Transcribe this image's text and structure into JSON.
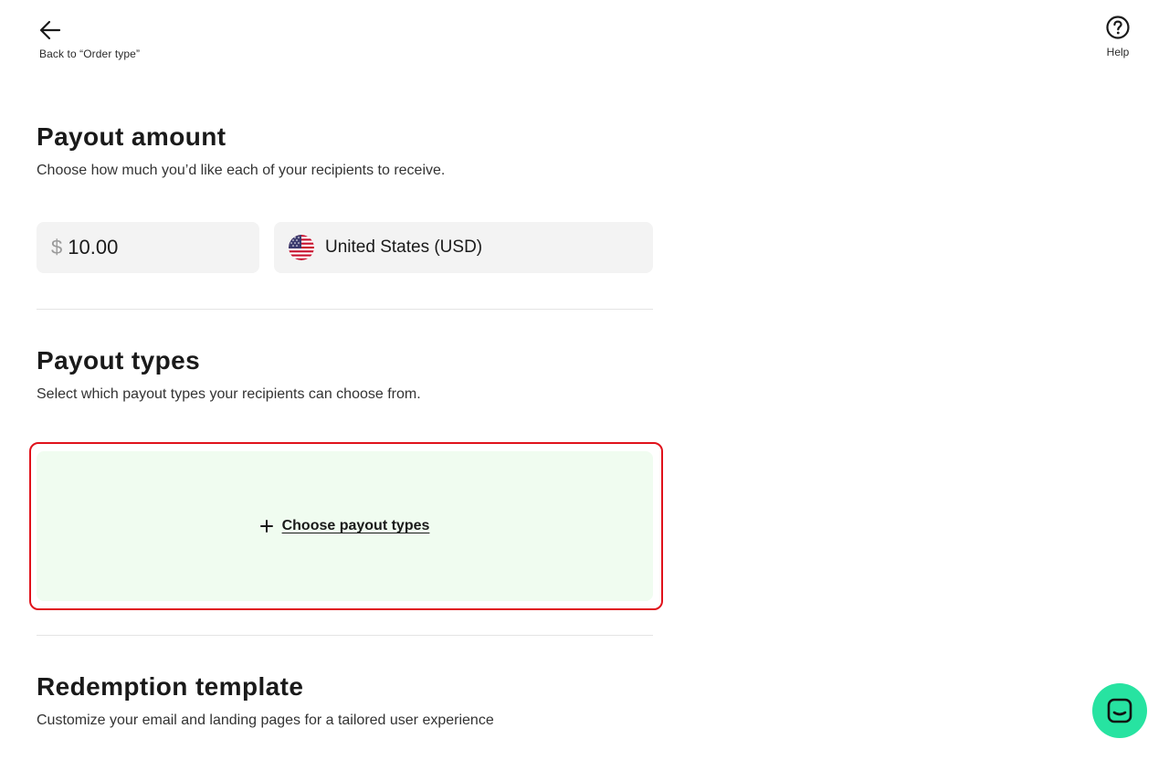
{
  "nav": {
    "back_label": "Back to “Order type”",
    "help_label": "Help"
  },
  "payout_amount": {
    "title": "Payout amount",
    "description": "Choose how much you’d like each of your recipients to receive.",
    "currency_symbol": "$",
    "amount_value": "10.00",
    "country_label": "United States (USD)",
    "flag_icon": "us-flag-icon"
  },
  "payout_types": {
    "title": "Payout types",
    "description": "Select which payout types your recipients can choose from.",
    "choose_label": "Choose payout types"
  },
  "redemption_template": {
    "title": "Redemption template",
    "description": "Customize your email and landing pages for a tailored user experience"
  },
  "colors": {
    "accent_green": "#27e3a1",
    "highlight_red": "#e0121b",
    "choose_bg": "#f0fcf0",
    "field_bg": "#f3f3f3"
  }
}
